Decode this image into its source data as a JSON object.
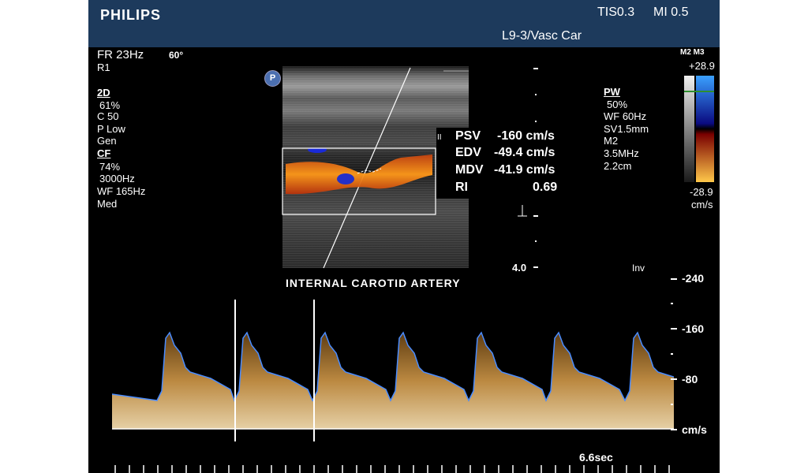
{
  "header": {
    "brand": "PHILIPS",
    "tis": "TIS0.3",
    "mi": "MI 0.5",
    "probe": "L9-3/Vasc Car"
  },
  "left_params": {
    "fr": "FR 23Hz",
    "angle": "60°",
    "r": "R1",
    "twod_title": "2D",
    "twod_gain": "61%",
    "twod_c": "C 50",
    "twod_p": "P Low",
    "twod_gen": "Gen",
    "cf_title": "CF",
    "cf_gain": "74%",
    "cf_freq": "3000Hz",
    "cf_wf": "WF 165Hz",
    "cf_med": "Med"
  },
  "right_params": {
    "pw_title": "PW",
    "pw_gain": "50%",
    "pw_wf": "WF  60Hz",
    "pw_sv": "SV1.5mm",
    "pw_m2": "M2",
    "pw_freq": "3.5MHz",
    "pw_depth": "2.2cm"
  },
  "colorbar": {
    "label": "M2 M3",
    "max": "+28.9",
    "min": "-28.9",
    "unit": "cm/s"
  },
  "measurements": {
    "marker": "II",
    "psv_label": "PSV",
    "psv_value": "-160 cm/s",
    "edv_label": "EDV",
    "edv_value": "-49.4 cm/s",
    "mdv_label": "MDV",
    "mdv_value": "-41.9 cm/s",
    "ri_label": "RI",
    "ri_value": "0.69"
  },
  "depth_scale": {
    "value": "4.0"
  },
  "inv_label": "Inv",
  "image_label": "INTERNAL CAROTID ARTERY",
  "velocity_scale": {
    "tick_240": "-240",
    "tick_160": "-160",
    "tick_80": "-80",
    "unit": "cm/s"
  },
  "time_label": "6.6sec",
  "logo_text": "P",
  "colors": {
    "header_bg": "#1d3a5c",
    "envelope": "#4a8cff",
    "spectrum": "#c08a3c"
  }
}
